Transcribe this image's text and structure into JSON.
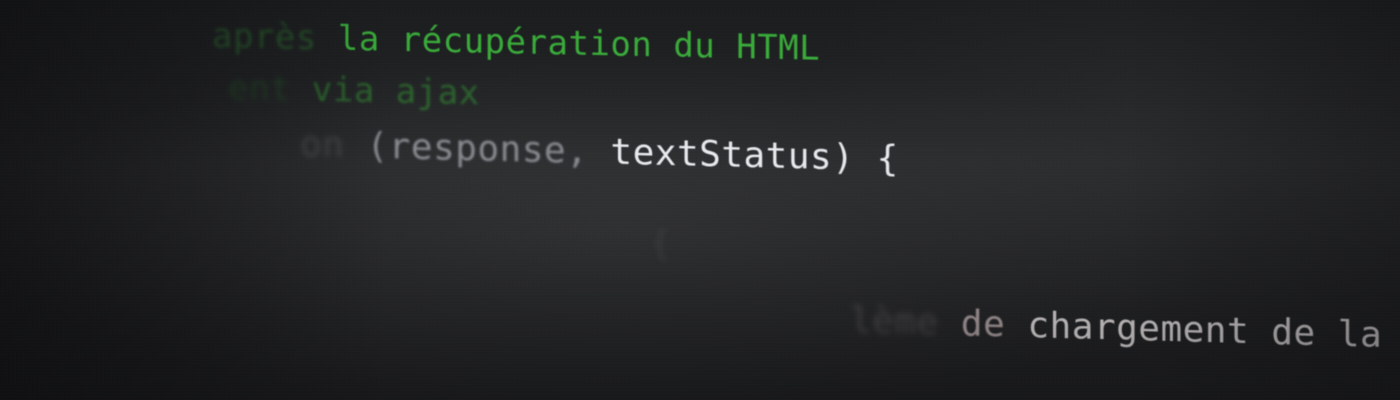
{
  "colors": {
    "background": "#1e2022",
    "comment_green": "#3fbf3f",
    "code_white": "#e9ebef",
    "code_gray": "#8a8c92",
    "string_pink": "#b8a9aa"
  },
  "code_lines": {
    "line1": {
      "faded": "après",
      "text": " la récupération du HTML"
    },
    "line2": {
      "faded": "ent",
      "text": " via ajax"
    },
    "line3": {
      "ghost": "on",
      "gray": " (response,",
      "white": " textStatus) {"
    },
    "line4": {
      "ghost": "{"
    },
    "line5": {
      "ghost": "lème",
      "mid": " de",
      "near": " chargement de la"
    }
  }
}
